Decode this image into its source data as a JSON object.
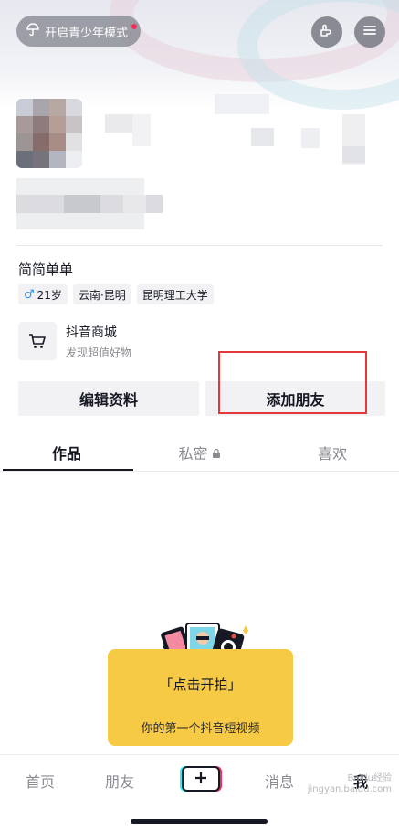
{
  "header": {
    "teen_mode_label": "开启青少年模式",
    "colors": {
      "badge": "#fe2c55"
    }
  },
  "profile": {
    "bio": "简简单单",
    "tags": [
      {
        "icon": "male-icon",
        "label": "21岁"
      },
      {
        "label": "云南·昆明"
      },
      {
        "label": "昆明理工大学"
      }
    ],
    "shop": {
      "title": "抖音商城",
      "subtitle": "发现超值好物"
    }
  },
  "actions": {
    "edit_profile": "编辑资料",
    "add_friends": "添加朋友"
  },
  "tabs": [
    {
      "label": "作品",
      "active": true
    },
    {
      "label": "私密",
      "icon": "lock-icon"
    },
    {
      "label": "喜欢"
    }
  ],
  "promo": {
    "title": "「点击开拍」",
    "subtitle": "你的第一个抖音短视频"
  },
  "bottom_nav": {
    "home": "首页",
    "friends": "朋友",
    "messages": "消息",
    "me": "我"
  },
  "watermark": {
    "line1": "Baidu经验",
    "line2": "jingyan.baidu.com"
  }
}
